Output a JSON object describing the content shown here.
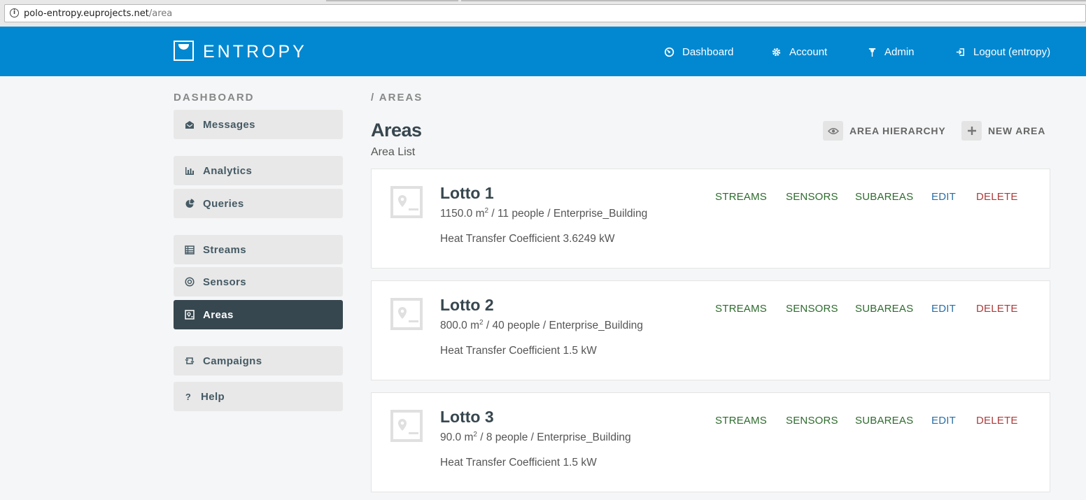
{
  "browser": {
    "url_host": "polo-entropy.euprojects.net",
    "url_path": "/area",
    "info_icon": "info-icon"
  },
  "header": {
    "logo_text": "ENTROPY",
    "nav": [
      {
        "label": "Dashboard",
        "icon": "dashboard-icon"
      },
      {
        "label": "Account",
        "icon": "gear-icon"
      },
      {
        "label": "Admin",
        "icon": "pin-icon"
      },
      {
        "label": "Logout (entropy)",
        "icon": "logout-icon"
      }
    ]
  },
  "sidebar": {
    "title": "DASHBOARD",
    "items": [
      {
        "label": "Messages",
        "icon": "envelope-icon"
      },
      {
        "label": "Analytics",
        "icon": "bar-chart-icon"
      },
      {
        "label": "Queries",
        "icon": "pie-chart-icon"
      },
      {
        "label": "Streams",
        "icon": "table-icon"
      },
      {
        "label": "Sensors",
        "icon": "target-icon"
      },
      {
        "label": "Areas",
        "icon": "map-icon",
        "active": true
      },
      {
        "label": "Campaigns",
        "icon": "cycle-icon"
      },
      {
        "label": "Help",
        "icon": "question-icon"
      }
    ]
  },
  "main": {
    "breadcrumb": "/ AREAS",
    "title": "Areas",
    "subtitle": "Area List",
    "actions": {
      "hierarchy": "AREA HIERARCHY",
      "new_area": "NEW AREA"
    },
    "card_actions": {
      "streams": "STREAMS",
      "sensors": "SENSORS",
      "subareas": "SUBAREAS",
      "edit": "EDIT",
      "delete": "DELETE"
    },
    "areas": [
      {
        "name": "Lotto 1",
        "area": "1150.0 m",
        "unit_sup": "2",
        "details": " / 11 people / Enterprise_Building",
        "htc": "Heat Transfer Coefficient 3.6249 kW"
      },
      {
        "name": "Lotto 2",
        "area": "800.0 m",
        "unit_sup": "2",
        "details": " / 40 people / Enterprise_Building",
        "htc": "Heat Transfer Coefficient 1.5 kW"
      },
      {
        "name": "Lotto 3",
        "area": "90.0 m",
        "unit_sup": "2",
        "details": " / 8 people / Enterprise_Building",
        "htc": "Heat Transfer Coefficient 1.5 kW"
      }
    ]
  },
  "colors": {
    "header_bg": "#0288d1",
    "sidebar_active_bg": "#37474f",
    "action_green": "#2e6b2e",
    "action_blue": "#2a6fa6",
    "action_red": "#b03a3a"
  }
}
